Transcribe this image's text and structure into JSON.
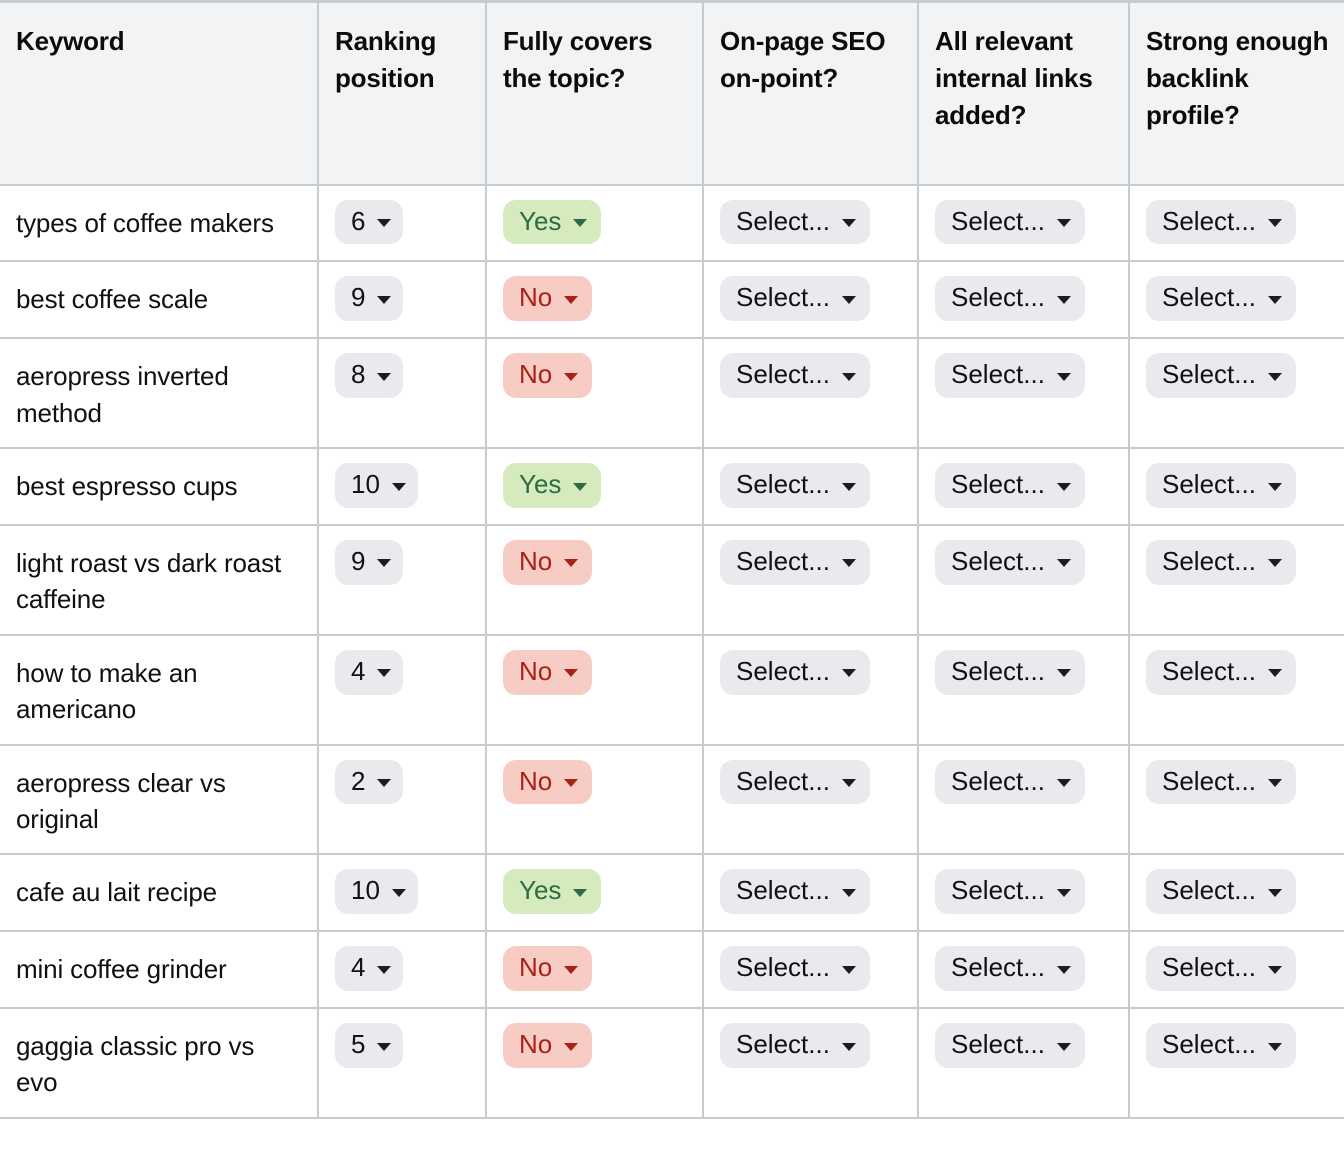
{
  "table": {
    "columns": [
      {
        "key": "keyword",
        "label": "Keyword"
      },
      {
        "key": "rank",
        "label": "Ranking position"
      },
      {
        "key": "covers",
        "label": "Fully covers the topic?"
      },
      {
        "key": "onpage",
        "label": "On-page SEO on-point?"
      },
      {
        "key": "links",
        "label": "All relevant internal links added?"
      },
      {
        "key": "backlink",
        "label": "Strong enough backlink profile?"
      }
    ],
    "select_placeholder": "Select...",
    "colors": {
      "header_bg": "#f1f3f5",
      "border": "#c6cbd1",
      "pill_bg": "#e8eaed",
      "yes_bg": "#d5ebbd",
      "yes_text": "#2c6b43",
      "no_bg": "#f7ccc5",
      "no_text": "#ab2117"
    },
    "rows": [
      {
        "keyword": "types of coffee makers",
        "rank": "6",
        "covers": "Yes",
        "onpage": "Select...",
        "links": "Select...",
        "backlink": "Select..."
      },
      {
        "keyword": "best coffee scale",
        "rank": "9",
        "covers": "No",
        "onpage": "Select...",
        "links": "Select...",
        "backlink": "Select..."
      },
      {
        "keyword": "aeropress inverted method",
        "rank": "8",
        "covers": "No",
        "onpage": "Select...",
        "links": "Select...",
        "backlink": "Select..."
      },
      {
        "keyword": "best espresso cups",
        "rank": "10",
        "covers": "Yes",
        "onpage": "Select...",
        "links": "Select...",
        "backlink": "Select..."
      },
      {
        "keyword": "light roast vs dark roast caffeine",
        "rank": "9",
        "covers": "No",
        "onpage": "Select...",
        "links": "Select...",
        "backlink": "Select..."
      },
      {
        "keyword": "how to make an americano",
        "rank": "4",
        "covers": "No",
        "onpage": "Select...",
        "links": "Select...",
        "backlink": "Select..."
      },
      {
        "keyword": "aeropress clear vs original",
        "rank": "2",
        "covers": "No",
        "onpage": "Select...",
        "links": "Select...",
        "backlink": "Select..."
      },
      {
        "keyword": "cafe au lait recipe",
        "rank": "10",
        "covers": "Yes",
        "onpage": "Select...",
        "links": "Select...",
        "backlink": "Select..."
      },
      {
        "keyword": "mini coffee grinder",
        "rank": "4",
        "covers": "No",
        "onpage": "Select...",
        "links": "Select...",
        "backlink": "Select..."
      },
      {
        "keyword": "gaggia classic pro vs evo",
        "rank": "5",
        "covers": "No",
        "onpage": "Select...",
        "links": "Select...",
        "backlink": "Select..."
      }
    ]
  }
}
